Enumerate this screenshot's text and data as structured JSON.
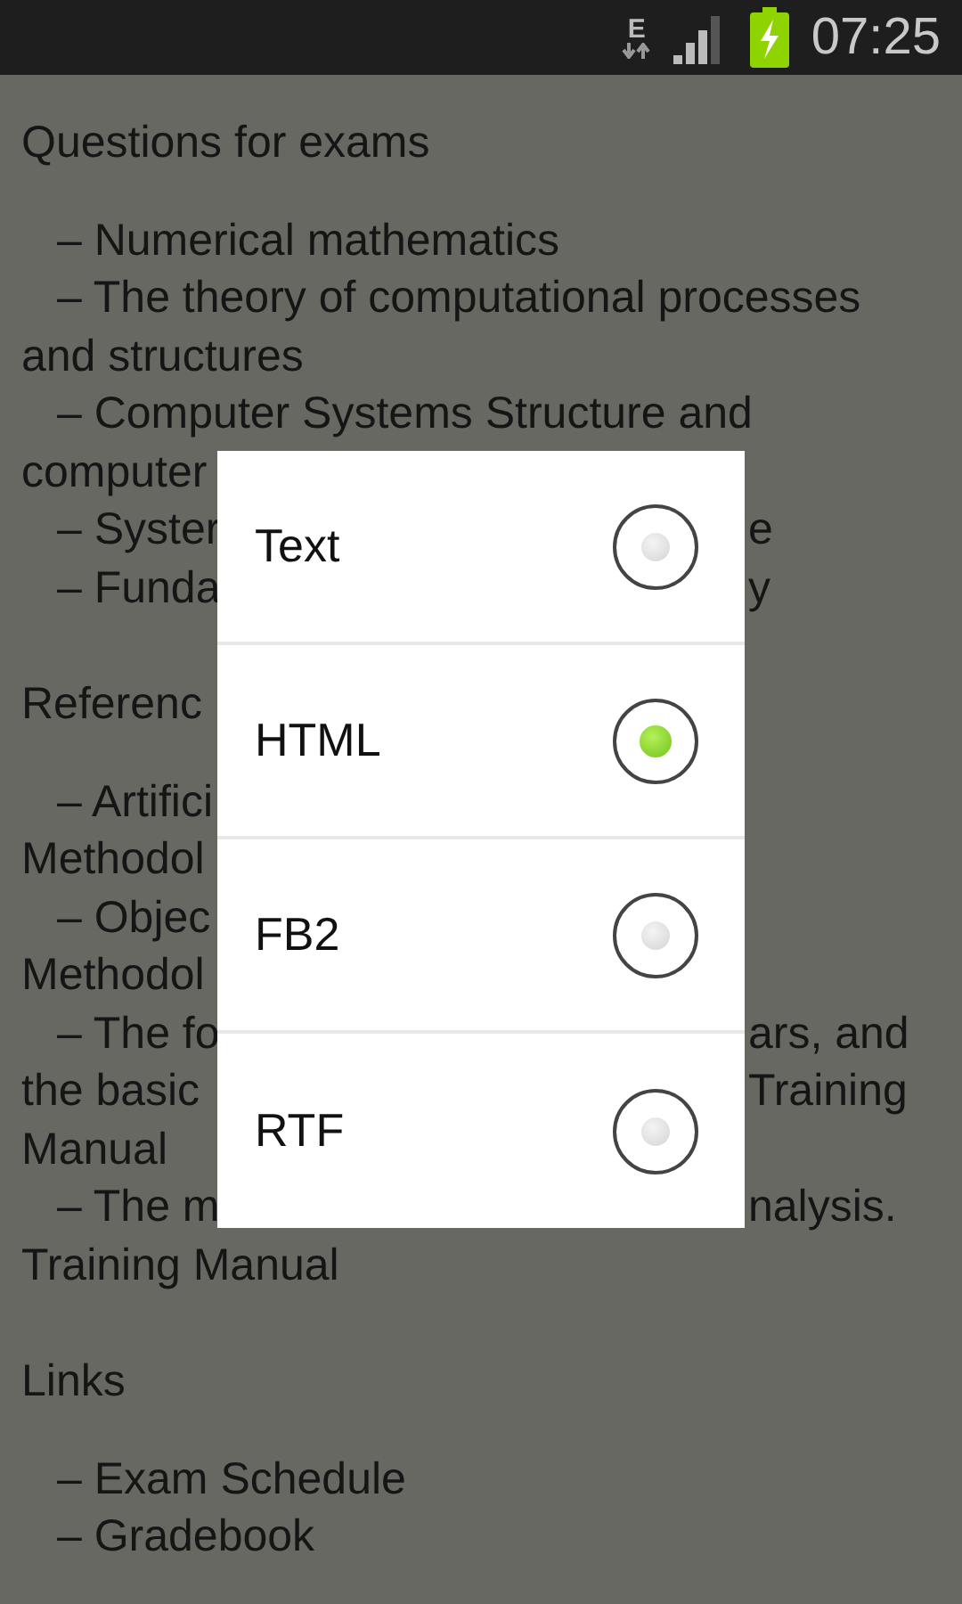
{
  "status_bar": {
    "network": "E",
    "time": "07:25"
  },
  "content": [
    {
      "kind": "heading",
      "text": "Questions for exams"
    },
    {
      "kind": "item",
      "text": "– Numerical mathematics"
    },
    {
      "kind": "item",
      "text": "– The theory of computational processes"
    },
    {
      "kind": "line",
      "text": "and structures"
    },
    {
      "kind": "item",
      "text": "– Computer Systems Structure and"
    },
    {
      "kind": "line",
      "text": "computer"
    },
    {
      "kind": "item",
      "text": "– Syster",
      "right": "e"
    },
    {
      "kind": "item",
      "text": "– Funda",
      "right": "y"
    },
    {
      "kind": "heading",
      "text": "Referenc"
    },
    {
      "kind": "item",
      "text": "– Artifici"
    },
    {
      "kind": "line",
      "text": "Methodol"
    },
    {
      "kind": "item",
      "text": "– Objec"
    },
    {
      "kind": "line",
      "text": "Methodol"
    },
    {
      "kind": "item",
      "text": "– The fo",
      "right": "ars, and"
    },
    {
      "kind": "line",
      "text": "the basic",
      "right": "Training"
    },
    {
      "kind": "line",
      "text": "Manual"
    },
    {
      "kind": "item",
      "text": "– The m",
      "right": "nalysis."
    },
    {
      "kind": "line",
      "text": "Training Manual"
    },
    {
      "kind": "heading",
      "text": "Links"
    },
    {
      "kind": "item",
      "text": "– Exam Schedule"
    },
    {
      "kind": "item",
      "text": "– Gradebook"
    }
  ],
  "dialog": {
    "options": [
      {
        "label": "Text",
        "selected": false
      },
      {
        "label": "HTML",
        "selected": true
      },
      {
        "label": "FB2",
        "selected": false
      },
      {
        "label": "RTF",
        "selected": false
      }
    ]
  }
}
